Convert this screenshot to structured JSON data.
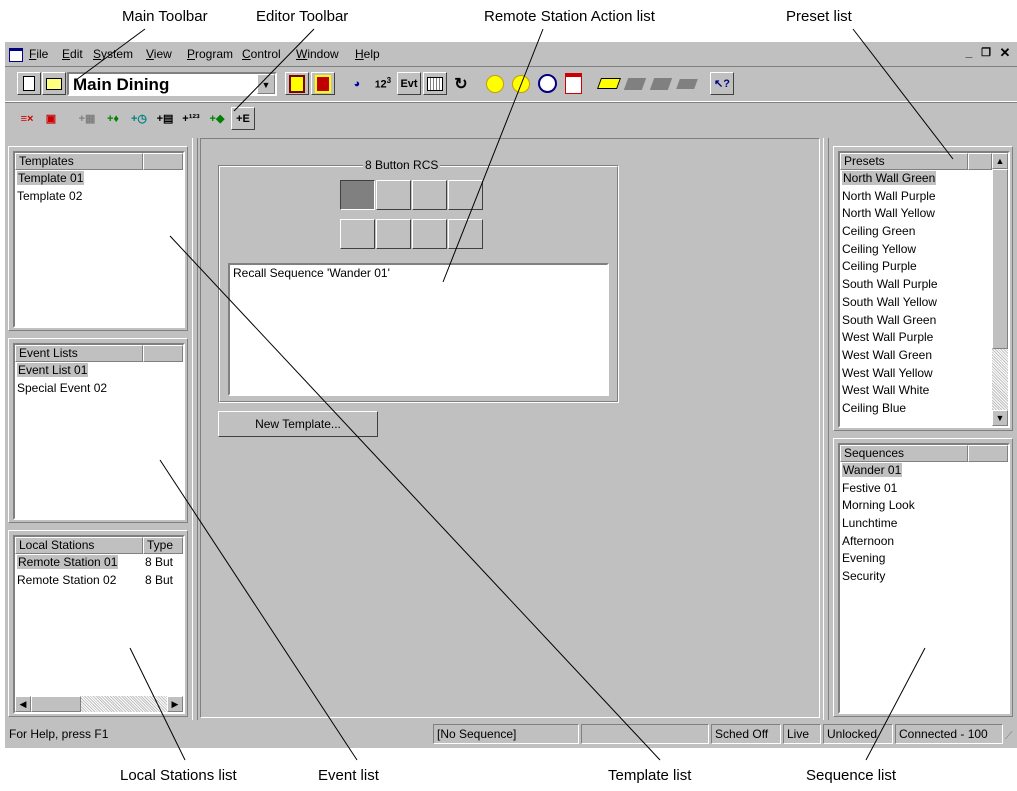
{
  "callouts": {
    "main_toolbar": "Main Toolbar",
    "editor_toolbar": "Editor Toolbar",
    "remote_action_list": "Remote Station Action list",
    "preset_list": "Preset list",
    "local_stations_list": "Local Stations list",
    "event_list": "Event list",
    "template_list": "Template list",
    "sequence_list": "Sequence list"
  },
  "menu": {
    "file": "File",
    "edit": "Edit",
    "system": "System",
    "view": "View",
    "program": "Program",
    "control": "Control",
    "window": "Window",
    "help": "Help"
  },
  "toolbar": {
    "location_value": "Main Dining",
    "evt_label": "Evt",
    "seq_label": "123"
  },
  "templates": {
    "header": "Templates",
    "items": [
      "Template 01",
      "Template 02"
    ]
  },
  "event_lists": {
    "header": "Event Lists",
    "items": [
      "Event List 01",
      "Special Event 02"
    ]
  },
  "local_stations": {
    "header_name": "Local Stations",
    "header_type": "Type",
    "rows": [
      {
        "name": "Remote Station 01",
        "type": "8 But"
      },
      {
        "name": "Remote Station 02",
        "type": "8 But"
      }
    ]
  },
  "editor": {
    "group_title": "8 Button RCS",
    "action_text": "Recall Sequence 'Wander 01'",
    "new_template_button": "New Template..."
  },
  "presets": {
    "header": "Presets",
    "items": [
      "North Wall Green",
      "North Wall Purple",
      "North Wall Yellow",
      "Ceiling Green",
      "Ceiling Yellow",
      "Ceiling Purple",
      "South Wall Purple",
      "South Wall Yellow",
      "South Wall Green",
      "West Wall Purple",
      "West Wall Green",
      "West Wall Yellow",
      "West Wall White",
      "Ceiling Blue"
    ]
  },
  "sequences": {
    "header": "Sequences",
    "items": [
      "Wander 01",
      "Festive 01",
      "Morning Look",
      "Lunchtime",
      "Afternoon",
      "Evening",
      "Security"
    ]
  },
  "statusbar": {
    "help": "For Help, press F1",
    "sequence": "[No Sequence]",
    "sched": "Sched Off",
    "live": "Live",
    "lock": "Unlocked",
    "connection": "Connected - 100"
  },
  "colors": {
    "face": "#c0c0c0",
    "selection": "#c0c0c0",
    "shadow": "#808080"
  }
}
